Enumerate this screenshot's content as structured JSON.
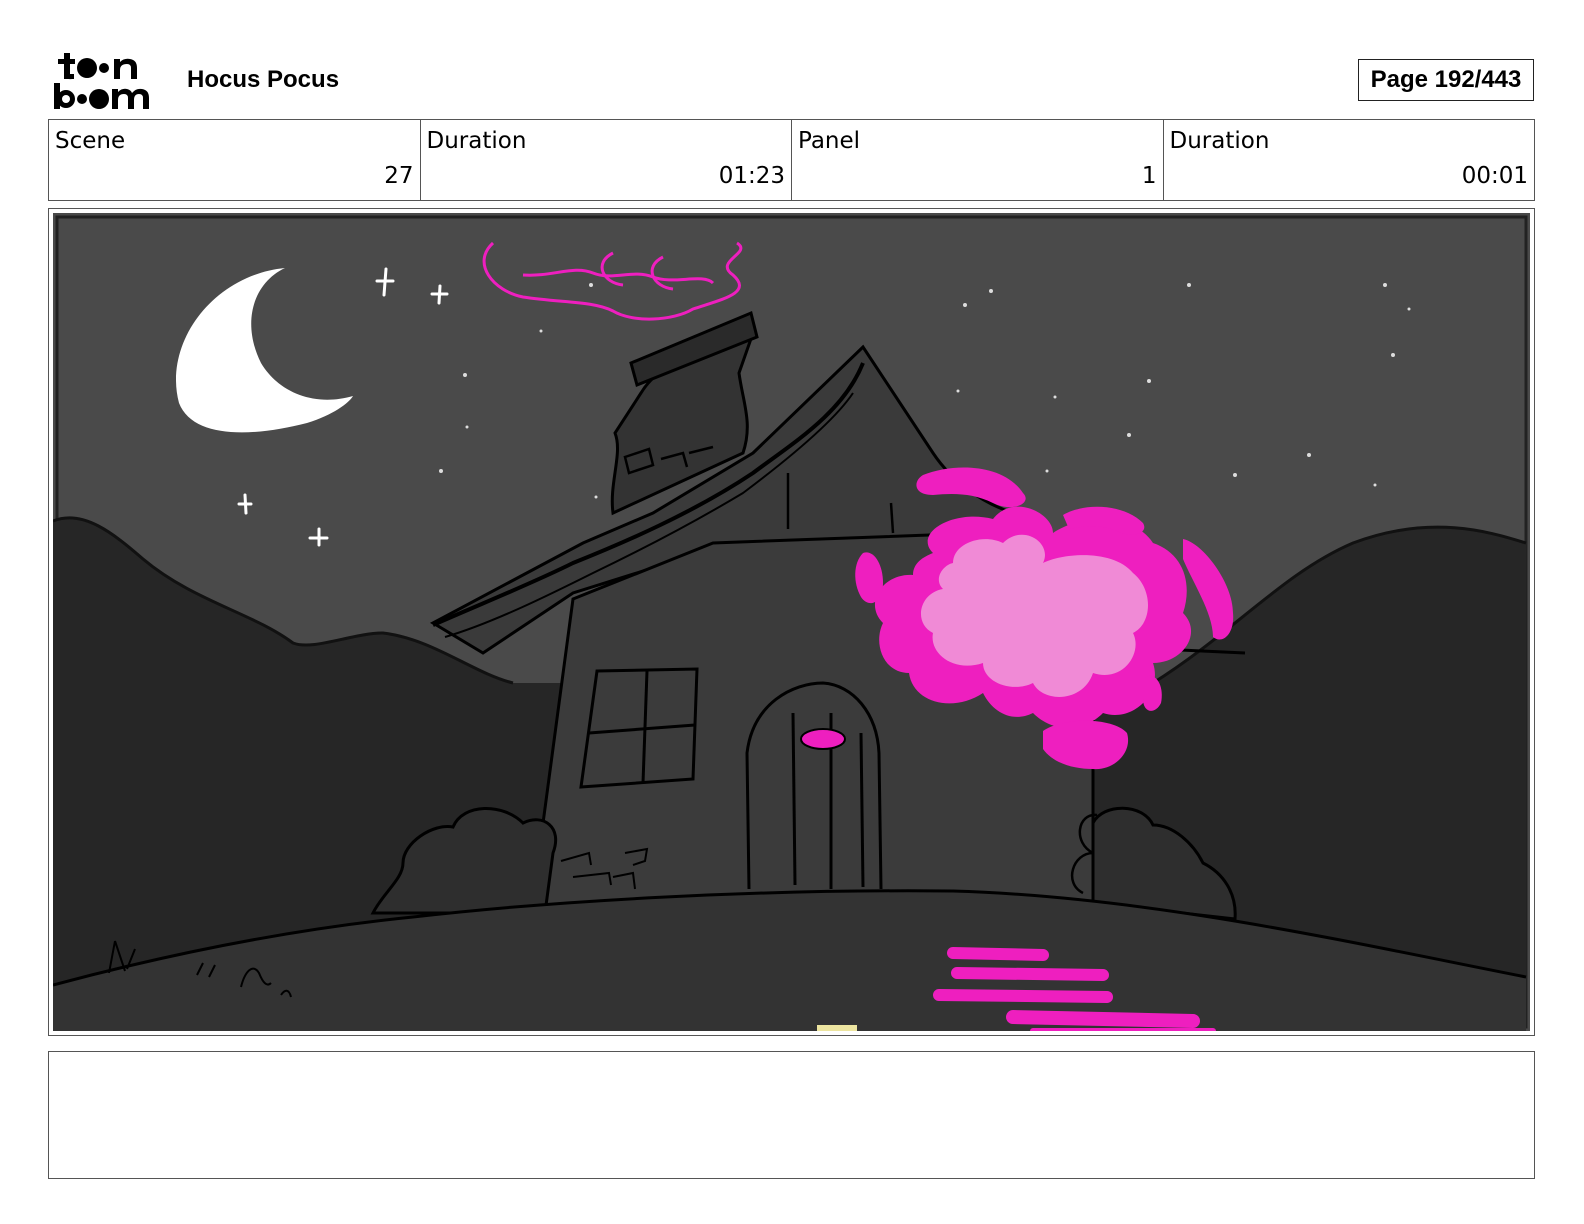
{
  "header": {
    "logo_text": "toonboom",
    "title": "Hocus Pocus",
    "page": "Page 192/443"
  },
  "info": {
    "scene_label": "Scene",
    "scene_value": "27",
    "scene_duration_label": "Duration",
    "scene_duration_value": "01:23",
    "panel_label": "Panel",
    "panel_value": "1",
    "panel_duration_label": "Duration",
    "panel_duration_value": "00:01"
  },
  "panel": {
    "description": "",
    "colors": {
      "sky": "#4a4a4a",
      "hills": "#262626",
      "ground": "#333333",
      "house": "#3b3b3b",
      "moon": "#ffffff",
      "magic": "#ee1fbf",
      "magic_light": "#f08ad6"
    }
  },
  "notes": {
    "text": ""
  }
}
